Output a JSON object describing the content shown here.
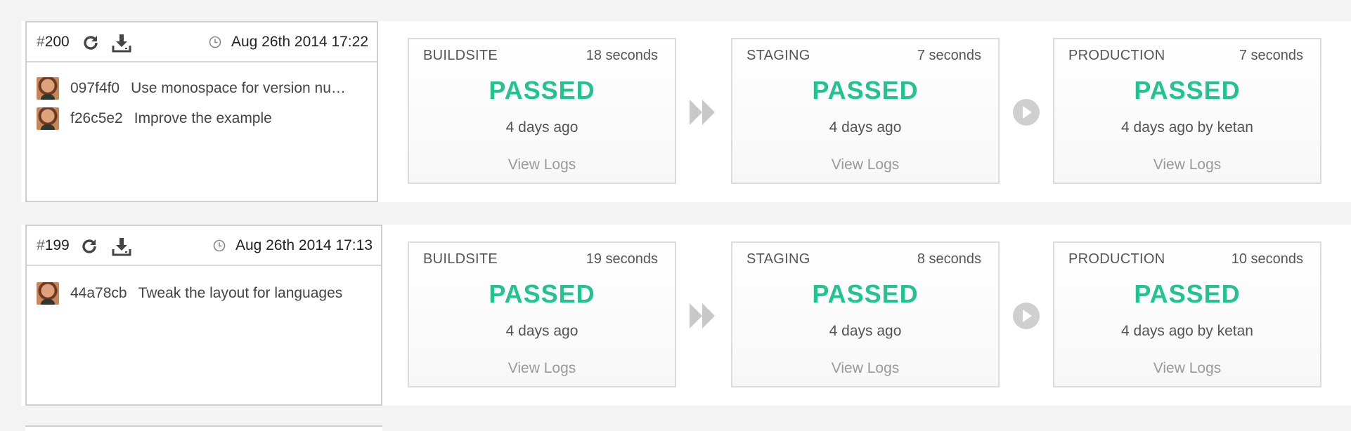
{
  "builds": [
    {
      "hash": "#",
      "number": "200",
      "timestamp": "Aug 26th 2014 17:22",
      "commits": [
        {
          "sha": "097f4f0",
          "message": "Use monospace for version nu…"
        },
        {
          "sha": "f26c5e2",
          "message": "Improve the example"
        }
      ],
      "stages": [
        {
          "name": "BUILDSITE",
          "duration": "18 seconds",
          "status": "PASSED",
          "ago": "4 days ago",
          "logs": "View Logs"
        },
        {
          "name": "STAGING",
          "duration": "7 seconds",
          "status": "PASSED",
          "ago": "4 days ago",
          "logs": "View Logs"
        },
        {
          "name": "PRODUCTION",
          "duration": "7 seconds",
          "status": "PASSED",
          "ago": "4 days ago by ketan",
          "logs": "View Logs"
        }
      ]
    },
    {
      "hash": "#",
      "number": "199",
      "timestamp": "Aug 26th 2014 17:13",
      "commits": [
        {
          "sha": "44a78cb",
          "message": "Tweak the layout for languages"
        }
      ],
      "stages": [
        {
          "name": "BUILDSITE",
          "duration": "19 seconds",
          "status": "PASSED",
          "ago": "4 days ago",
          "logs": "View Logs"
        },
        {
          "name": "STAGING",
          "duration": "8 seconds",
          "status": "PASSED",
          "ago": "4 days ago",
          "logs": "View Logs"
        },
        {
          "name": "PRODUCTION",
          "duration": "10 seconds",
          "status": "PASSED",
          "ago": "4 days ago by ketan",
          "logs": "View Logs"
        }
      ]
    }
  ],
  "icons": {
    "rerun": "rerun-icon",
    "download": "download-icon",
    "clock": "clock-icon",
    "auto_trigger": "fast-forward-icon",
    "manual_trigger": "play-icon"
  },
  "colors": {
    "passed": "#1fc48f",
    "border": "#dcdcdc",
    "background": "#f3f3f3"
  }
}
